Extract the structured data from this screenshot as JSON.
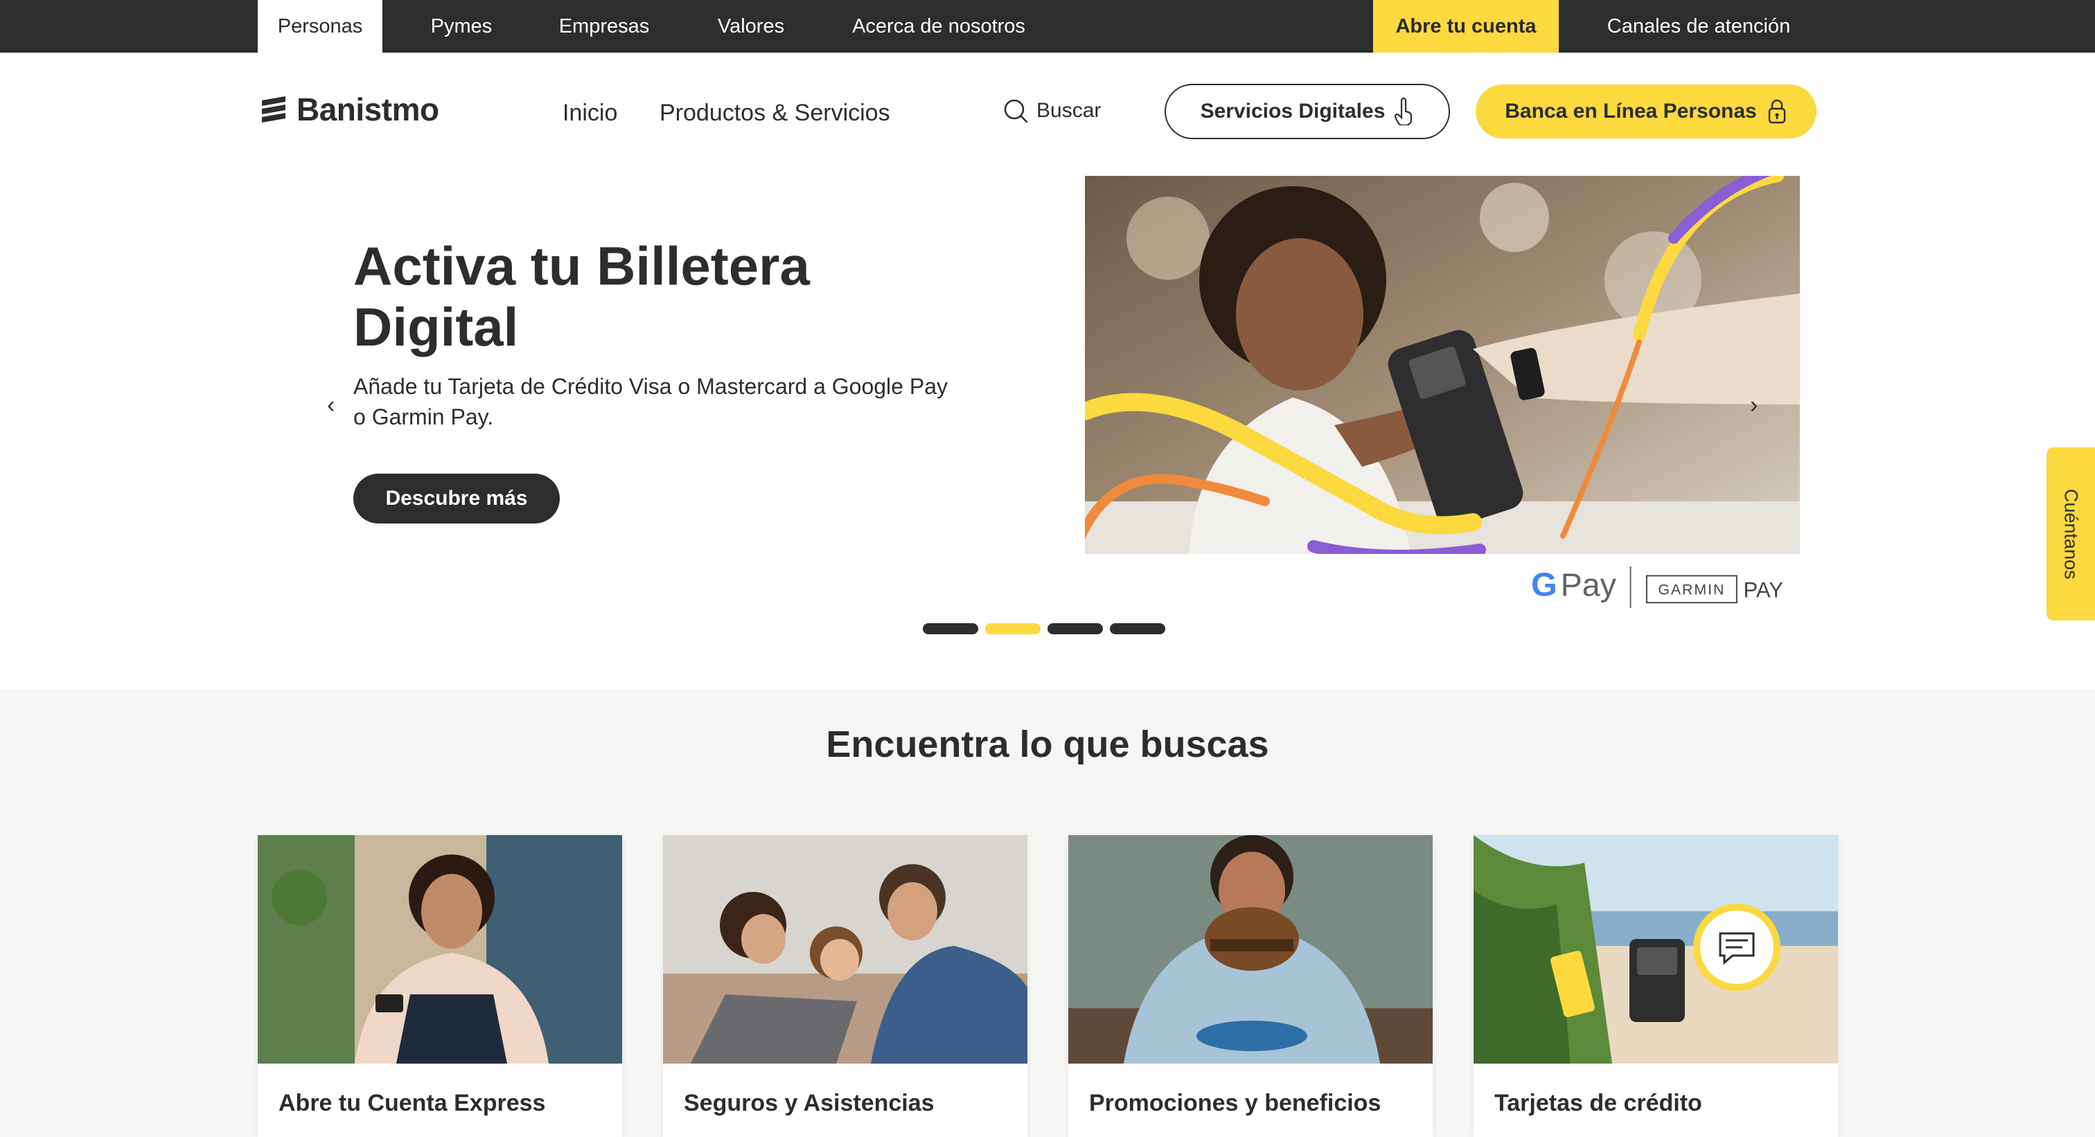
{
  "topbar": {
    "tabs": [
      "Personas",
      "Pymes",
      "Empresas",
      "Valores",
      "Acerca de nosotros"
    ],
    "open_account": "Abre tu cuenta",
    "channels": "Canales de atención"
  },
  "header": {
    "brand": "Banistmo",
    "nav": [
      "Inicio",
      "Productos & Servicios"
    ],
    "search_label": "Buscar",
    "digital_services": "Servicios Digitales",
    "online_banking": "Banca en Línea Personas"
  },
  "hero": {
    "title": "Activa tu Billetera Digital",
    "subtitle": "Añade tu Tarjeta de Crédito Visa o Mastercard a Google Pay o Garmin Pay.",
    "cta": "Descubre más",
    "prev_glyph": "‹",
    "next_glyph": "›",
    "gpay_text": "Pay",
    "garmin_text": "GARMIN",
    "garmin_pay": "PAY",
    "slides_total": 4,
    "active_slide": 2
  },
  "side_tab": "Cuéntanos",
  "find": {
    "title": "Encuentra lo que buscas",
    "cards": [
      "Abre tu Cuenta Express",
      "Seguros y Asistencias",
      "Promociones y beneficios",
      "Tarjetas de crédito"
    ]
  },
  "colors": {
    "brand_yellow": "#fcd93f",
    "dark": "#2d2d2b",
    "accent_purple": "#8a5cd6",
    "accent_orange": "#f08a3c"
  }
}
